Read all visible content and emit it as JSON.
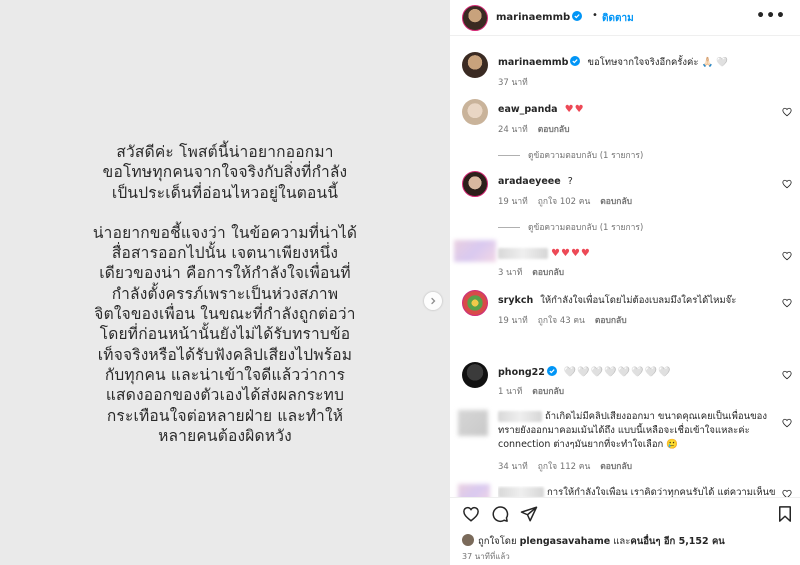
{
  "post": {
    "paragraph1": [
      "สวัสดีค่ะ โพสต์นี้น่าอยากออกมา",
      "ขอโทษทุกคนจากใจจริงกับสิ่งที่กำลัง",
      "เป็นประเด็นที่อ่อนไหวอยู่ในตอนนี้"
    ],
    "paragraph2": [
      "น่าอยากขอชี้แจงว่า ในข้อความที่น่าได้",
      "สื่อสารออกไปนั้น เจตนาเพียงหนึ่ง",
      "เดียวของน่า คือการให้กำลังใจเพื่อนที่",
      "กำลังตั้งครรภ์เพราะเป็นห่วงสภาพ",
      "จิตใจของเพื่อน ในขณะที่กำลังถูกต่อว่า",
      "โดยที่ก่อนหน้านั้นยังไม่ได้รับทราบข้อ",
      "เท็จจริงหรือได้รับฟังคลิปเสียงไปพร้อม",
      "กับทุกคน และน่าเข้าใจดีแล้วว่าการ",
      "แสดงออกของตัวเองได้ส่งผลกระทบ",
      "กระเทือนใจต่อหลายฝ่าย และทำให้",
      "หลายคนต้องผิดหวัง"
    ]
  },
  "header": {
    "username": "marinaemmb",
    "separator": "•",
    "follow_label": "ติดตาม",
    "more_label": "•••"
  },
  "caption": {
    "username": "marinaemmb",
    "text": "ขอโทษจากใจจริงอีกครั้งค่ะ 🙏🏻 🤍",
    "time": "37 นาที"
  },
  "comments": [
    {
      "username": "eaw_panda",
      "text": "♥♥",
      "time": "24 นาที",
      "reply_label": "ตอบกลับ",
      "view_replies": "ดูข้อความตอบกลับ (1 รายการ)"
    },
    {
      "username": "aradaeyeee",
      "text": "?",
      "time": "19 นาที",
      "likes": "ถูกใจ 102 คน",
      "reply_label": "ตอบกลับ",
      "view_replies": "ดูข้อความตอบกลับ (1 รายการ)"
    },
    {
      "text": "♥♥♥♥",
      "time": "3 นาที",
      "reply_label": "ตอบกลับ"
    },
    {
      "username": "srykch",
      "text": "ให้กำลังใจเพื่อนโดยไม่ต้องเบลมมึงใครได้ไหมจ๊ะ",
      "time": "19 นาที",
      "likes": "ถูกใจ 43 คน",
      "reply_label": "ตอบกลับ"
    },
    {
      "username": "phong22",
      "text": "🤍🤍🤍🤍🤍🤍🤍🤍",
      "time": "1 นาที",
      "reply_label": "ตอบกลับ"
    },
    {
      "text_line1": "ถ้าเกิดไม่มีคลิปเสียงออกมา ขนาดคุณเคยเป็นเพื่อนของ",
      "text_line2": "ทรายยังออกมาคอมเม้นได้ถึง แบบนี้เหลือจะเชื่อเข้าใจแหละค่ะ",
      "text_line3": "connection ต่างๆมันยากที่จะทำใจเลือก 🥲",
      "time": "34 นาที",
      "likes": "ถูกใจ 112 คน",
      "reply_label": "ตอบกลับ"
    },
    {
      "text": "การให้กำลังใจเพื่อน เราคิดว่าทุกคนรับได้ แต่ความเห็นข"
    }
  ],
  "footer": {
    "liked_prefix": "ถูกใจโดย",
    "liked_user": "plengasavahame",
    "liked_and": "และ",
    "liked_others": "คนอื่นๆ อีก 5,152 คน",
    "posted_time": "37 นาทีที่แล้ว"
  },
  "colors": {
    "accent": "#0095f6",
    "heart": "#ed4956",
    "verified": "#0095f6"
  }
}
